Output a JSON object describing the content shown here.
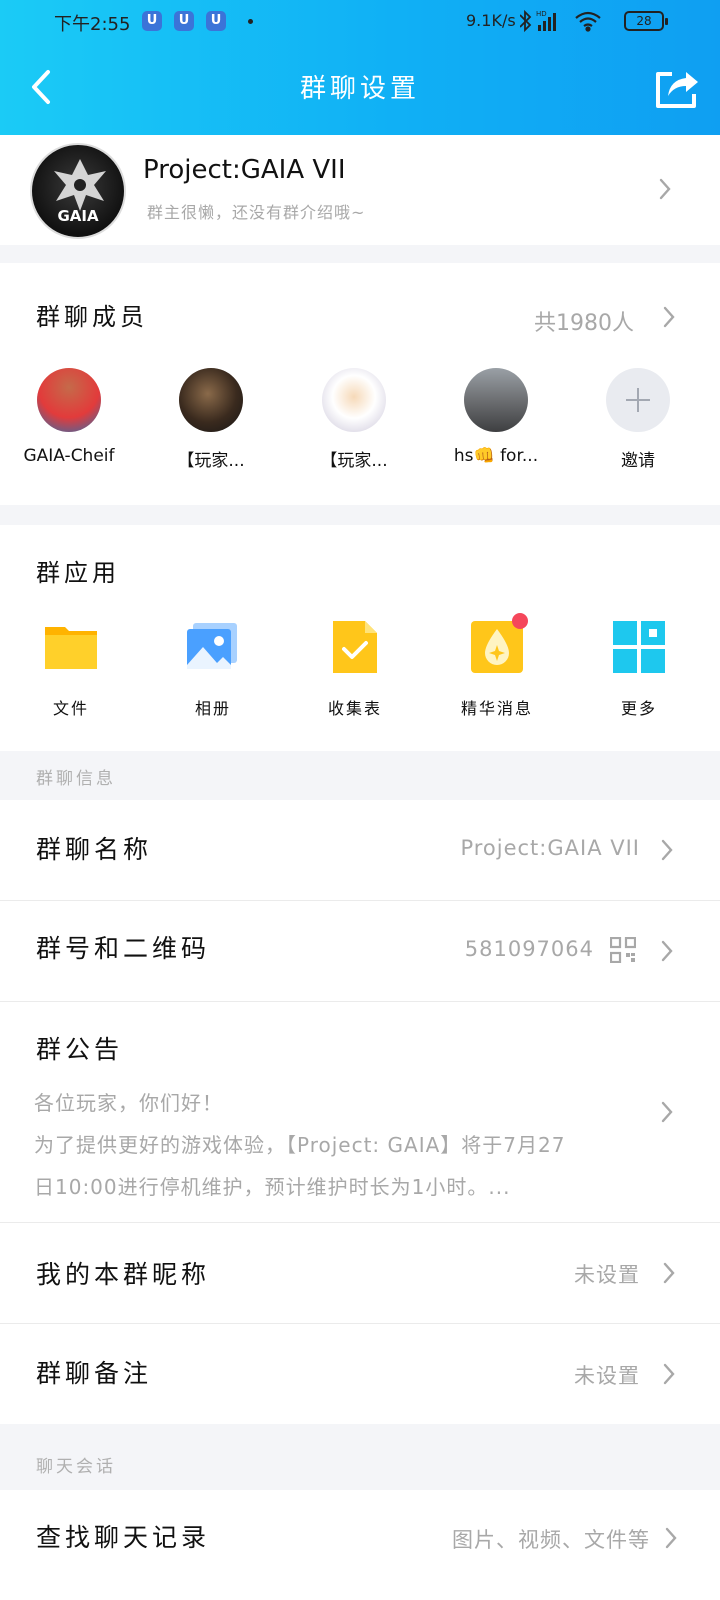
{
  "status_bar": {
    "time": "下午2:55",
    "app_icons": [
      "U",
      "U",
      "U"
    ],
    "net_speed": "9.1K/s",
    "battery": "28",
    "icons": [
      "bluetooth-icon",
      "signal-icon",
      "wifi-icon",
      "battery-icon"
    ]
  },
  "header": {
    "title": "群聊设置",
    "bg_gradient": [
      "#1bcbf6",
      "#0f9ff2"
    ]
  },
  "group": {
    "name": "Project:GAIA VII",
    "intro": "群主很懒，还没有群介绍哦~",
    "avatar_text": "GAIA"
  },
  "members": {
    "title": "群聊成员",
    "count": "共1980人",
    "list": [
      {
        "name": "GAIA-Cheif"
      },
      {
        "name": "【玩家..."
      },
      {
        "name": "【玩家..."
      },
      {
        "name": "hs👊 for..."
      },
      {
        "name": "邀请"
      }
    ]
  },
  "apps": {
    "title": "群应用",
    "items": [
      {
        "label": "文件",
        "icon": "folder-icon",
        "color": "#ffc61a"
      },
      {
        "label": "相册",
        "icon": "photo-album-icon",
        "color": "#5aa9ff"
      },
      {
        "label": "收集表",
        "icon": "form-check-icon",
        "color": "#ffc11a"
      },
      {
        "label": "精华消息",
        "icon": "essence-message-icon",
        "color": "#ffc61a"
      },
      {
        "label": "更多",
        "icon": "more-grid-icon",
        "color": "#1ec8ee"
      }
    ]
  },
  "info": {
    "section_label": "群聊信息",
    "name_row": {
      "label": "群聊名称",
      "value": "Project:GAIA VII"
    },
    "number_row": {
      "label": "群号和二维码",
      "value": "581097064"
    },
    "notice": {
      "label": "群公告",
      "line1": "各位玩家，你们好！",
      "line2": "为了提供更好的游戏体验，【Project: GAIA】将于7月27",
      "line3": "日10:00进行停机维护，预计维护时长为1小时。..."
    },
    "nickname_row": {
      "label": "我的本群昵称",
      "value": "未设置"
    },
    "remark_row": {
      "label": "群聊备注",
      "value": "未设置"
    }
  },
  "chat": {
    "section_label": "聊天会话",
    "search_row": {
      "label": "查找聊天记录",
      "value": "图片、视频、文件等"
    }
  }
}
